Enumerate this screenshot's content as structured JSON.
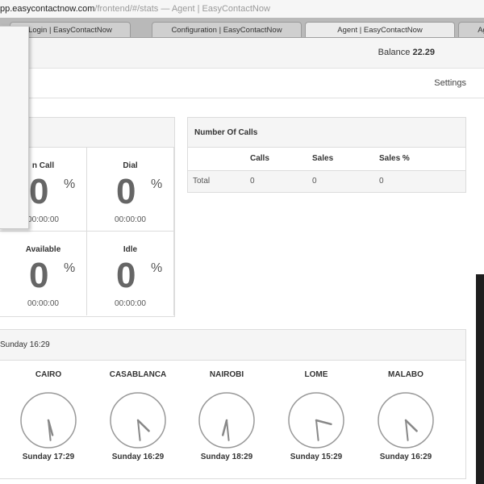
{
  "browser": {
    "url_host": "pp.easycontactnow.com",
    "url_path": "/frontend/#/stats",
    "title_sep": " — ",
    "page_title": "Agent | EasyContactNow"
  },
  "tabs": [
    {
      "label": "Login | EasyContactNow"
    },
    {
      "label": "Configuration | EasyContactNow"
    },
    {
      "label": "Agent | EasyContactNow"
    },
    {
      "label": "Ag"
    }
  ],
  "header": {
    "balance_label": "Balance",
    "balance_value": "22.29"
  },
  "nav": {
    "settings": "Settings"
  },
  "stats": [
    {
      "label": "n Call",
      "value": "0",
      "pct": "%",
      "time": "00:00:00"
    },
    {
      "label": "Dial",
      "value": "0",
      "pct": "%",
      "time": "00:00:00"
    },
    {
      "label": "Available",
      "value": "0",
      "pct": "%",
      "time": "00:00:00"
    },
    {
      "label": "Idle",
      "value": "0",
      "pct": "%",
      "time": "00:00:00"
    }
  ],
  "calls": {
    "title": "Number Of Calls",
    "headers": [
      "",
      "Calls",
      "Sales",
      "Sales %"
    ],
    "row": [
      "Total",
      "0",
      "0",
      "0"
    ]
  },
  "clocks": {
    "header": "Sunday 16:29",
    "items": [
      {
        "city": "CAIRO",
        "time": "Sunday 17:29",
        "hour": 17,
        "minute": 29
      },
      {
        "city": "CASABLANCA",
        "time": "Sunday 16:29",
        "hour": 16,
        "minute": 29
      },
      {
        "city": "NAIROBI",
        "time": "Sunday 18:29",
        "hour": 18,
        "minute": 29
      },
      {
        "city": "LOME",
        "time": "Sunday 15:29",
        "hour": 15,
        "minute": 29
      },
      {
        "city": "MALABO",
        "time": "Sunday 16:29",
        "hour": 16,
        "minute": 29
      }
    ]
  }
}
